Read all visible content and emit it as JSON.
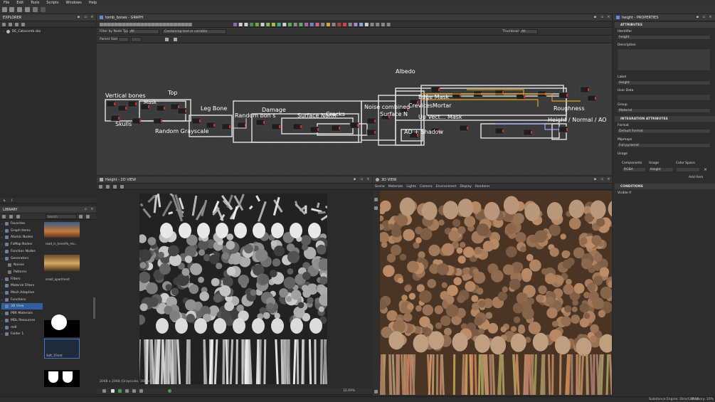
{
  "menu": [
    "File",
    "Edit",
    "Tools",
    "Scripts",
    "Windows",
    "Help"
  ],
  "explorer": {
    "title": "EXPLORER",
    "package": "DE_Catacomb.sbs"
  },
  "graph": {
    "title": "tomb_bones - GRAPH",
    "filter_label": "Filter by Node Type:",
    "filter_value": "All",
    "search_placeholder": "Containing text or variable",
    "thumbnails_label": "Thumbnails:",
    "thumbnails_value": "All",
    "parent_size_label": "Parent Size:",
    "nodes": [
      {
        "id": "vertical-bones",
        "label": "Vertical bones"
      },
      {
        "id": "top",
        "label": "Top"
      },
      {
        "id": "mask",
        "label": "Mask"
      },
      {
        "id": "leg-bone",
        "label": "Leg Bone"
      },
      {
        "id": "skulls",
        "label": "Skulls"
      },
      {
        "id": "random-grayscale",
        "label": "Random Grayscale"
      },
      {
        "id": "random-bones",
        "label": "Random bon s"
      },
      {
        "id": "damage",
        "label": "Damage"
      },
      {
        "id": "surface-norm",
        "label": "Surface Norm"
      },
      {
        "id": "cracks",
        "label": "Cracks"
      },
      {
        "id": "noise-combined",
        "label": "Noise combined"
      },
      {
        "id": "surface-normal2",
        "label": "Surface N"
      },
      {
        "id": "albedo",
        "label": "Albedo"
      },
      {
        "id": "edge-mask",
        "label": "Edge Mask"
      },
      {
        "id": "crevices",
        "label": "Crevices"
      },
      {
        "id": "mortar",
        "label": "Mortar"
      },
      {
        "id": "upvector-mask",
        "label": "Up Vect... Mask"
      },
      {
        "id": "ao-shadow",
        "label": "AO + Shadow"
      },
      {
        "id": "roughness",
        "label": "Roughness"
      },
      {
        "id": "height-normal-ao",
        "label": "Height / Normal / AO"
      }
    ]
  },
  "properties": {
    "title": "height - PROPERTIES",
    "section_attributes": "ATTRIBUTES",
    "identifier_label": "Identifier",
    "identifier_value": "height",
    "description_label": "Description",
    "label_label": "Label",
    "label_value": "Height",
    "user_data_label": "User Data",
    "group_label": "Group",
    "group_value": "Material",
    "section_integration": "INTEGRATION ATTRIBUTES",
    "format_label": "Format",
    "format_value": "Default Format",
    "mipmaps_label": "Mipmaps",
    "mipmaps_value": "Full pyramid",
    "usage_label": "Usage",
    "components_label": "Components",
    "usage_col_label": "Usage",
    "color_space_label": "Color Space",
    "components_value": "RGBA",
    "usage_value": "Height",
    "add_item_label": "Add Item",
    "section_conditions": "CONDITIONS",
    "visible_if_label": "Visible If"
  },
  "library": {
    "title": "LIBRARY",
    "search_placeholder": "Search",
    "categories": [
      "Favorites",
      "Graph Items",
      "Atomic Nodes",
      "FxMap Nodes",
      "Function Nodes",
      "Generators",
      "Noises",
      "Patterns",
      "Filters",
      "Material Filters",
      "Mesh Adaptive",
      "Functions",
      "3D View",
      "PBR Materials",
      "MDL Resources",
      "mdl",
      "Folder 1"
    ],
    "thumbs": [
      {
        "label": ""
      },
      {
        "label": "road_in_tenerife_mo..."
      },
      {
        "label": ""
      },
      {
        "label": "small_apartment"
      },
      {
        "label": ""
      },
      {
        "label": "Soft_1Front"
      },
      {
        "label": ""
      }
    ]
  },
  "view2d": {
    "title": "Height - 2D VIEW",
    "info": "2048 x 2048 (Grayscale, 16bpc)",
    "zoom": "32.69%"
  },
  "view3d": {
    "title": "3D VIEW",
    "menu": [
      "Scene",
      "Materials",
      "Lights",
      "Camera",
      "Environment",
      "Display",
      "Renderer"
    ]
  },
  "status": {
    "engine": "Substance Engine: Direct3D 10",
    "memory": "Memory: 10%"
  },
  "colors": {
    "bg": "#2a2a2a",
    "panel_header": "#3a3a3a",
    "graph_bg": "#3b3b3b",
    "node_edge": "#e0e0e0",
    "wire_orange": "#e0a020",
    "accent_blue": "#2f5f9f"
  }
}
